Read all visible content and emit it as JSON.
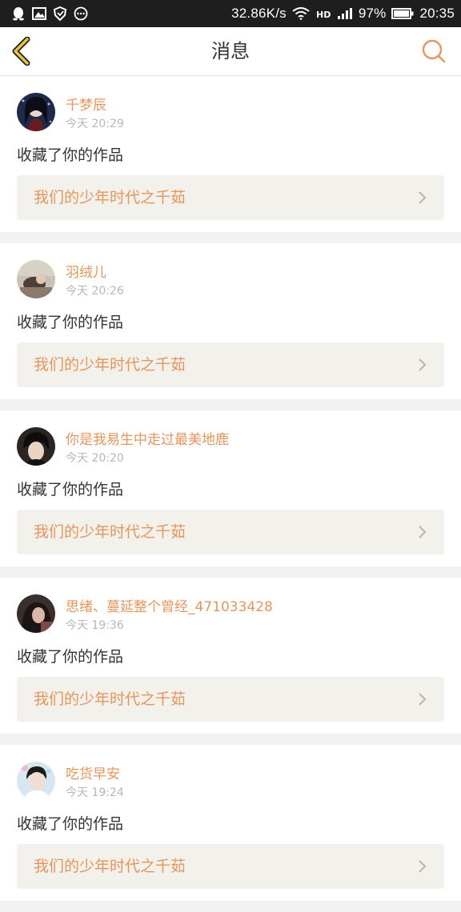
{
  "status_bar": {
    "net_speed": "32.86K/s",
    "battery": "97%",
    "time": "20:35",
    "left_icons": [
      "qq-icon",
      "image-icon",
      "shield-icon",
      "chat-icon"
    ],
    "right_icons": [
      "wifi-icon",
      "hd-icon",
      "signal-icon",
      "battery-icon"
    ]
  },
  "nav": {
    "title": "消息",
    "accent_color": "#e8955a",
    "back_icon_color": "#c8a21e"
  },
  "messages": [
    {
      "user": "千梦辰",
      "time": "今天 20:29",
      "action": "收藏了你的作品",
      "work": "我们的少年时代之千茹"
    },
    {
      "user": "羽绒儿",
      "time": "今天 20:26",
      "action": "收藏了你的作品",
      "work": "我们的少年时代之千茹"
    },
    {
      "user": "你是我易生中走过最美地鹿",
      "time": "今天 20:20",
      "action": "收藏了你的作品",
      "work": "我们的少年时代之千茹"
    },
    {
      "user": "思绪、蔓延整个曾经_471033428",
      "time": "今天 19:36",
      "action": "收藏了你的作品",
      "work": "我们的少年时代之千茹"
    },
    {
      "user": "吃货早安",
      "time": "今天 19:24",
      "action": "收藏了你的作品",
      "work": "我们的少年时代之千茹"
    }
  ]
}
